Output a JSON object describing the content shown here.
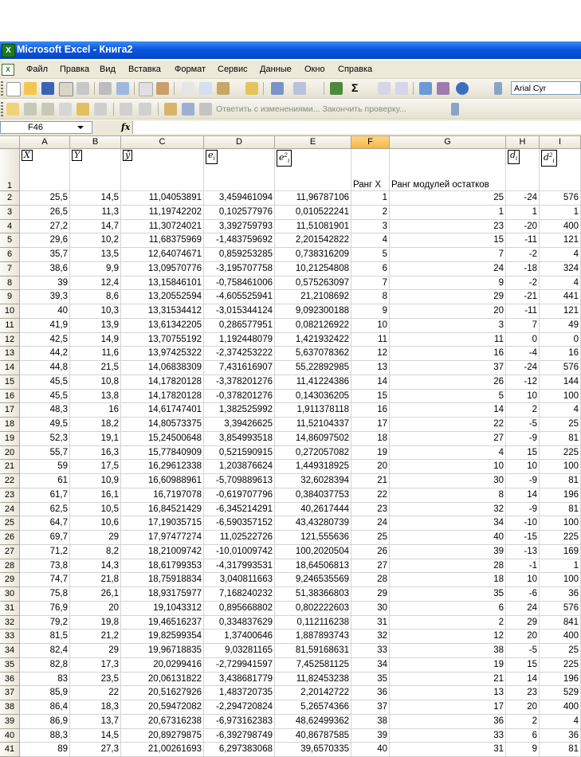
{
  "window": {
    "title": "Microsoft Excel - Книга2",
    "app_icon": "excel-icon"
  },
  "menu": [
    "Файл",
    "Правка",
    "Вид",
    "Вставка",
    "Формат",
    "Сервис",
    "Данные",
    "Окно",
    "Справка"
  ],
  "toolbar": {
    "font_name": "Arial Cyr",
    "review_text": "Ответить с изменениями... Закончить проверку...",
    "sum_glyph": "Σ"
  },
  "formula_bar": {
    "name_box": "F46",
    "fx": "fx",
    "formula": ""
  },
  "columns": [
    "A",
    "B",
    "C",
    "D",
    "E",
    "F",
    "G",
    "H",
    "I"
  ],
  "selected_column": "F",
  "header_row": {
    "A": "X",
    "B": "Y",
    "C": "ŷ",
    "D": "e_i",
    "E": "e_i²",
    "F": "Ранг X",
    "G": "Ранг модулей остатков",
    "H": "d_i",
    "I": "d_i²"
  },
  "rows": [
    [
      "25,5",
      "14,5",
      "11,04053891",
      "3,459461094",
      "11,96787106",
      "1",
      "25",
      "-24",
      "576"
    ],
    [
      "26,5",
      "11,3",
      "11,19742202",
      "0,102577976",
      "0,010522241",
      "2",
      "1",
      "1",
      "1"
    ],
    [
      "27,2",
      "14,7",
      "11,30724021",
      "3,392759793",
      "11,51081901",
      "3",
      "23",
      "-20",
      "400"
    ],
    [
      "29,6",
      "10,2",
      "11,68375969",
      "-1,483759692",
      "2,201542822",
      "4",
      "15",
      "-11",
      "121"
    ],
    [
      "35,7",
      "13,5",
      "12,64074671",
      "0,859253285",
      "0,738316209",
      "5",
      "7",
      "-2",
      "4"
    ],
    [
      "38,6",
      "9,9",
      "13,09570776",
      "-3,195707758",
      "10,21254808",
      "6",
      "24",
      "-18",
      "324"
    ],
    [
      "39",
      "12,4",
      "13,15846101",
      "-0,758461006",
      "0,575263097",
      "7",
      "9",
      "-2",
      "4"
    ],
    [
      "39,3",
      "8,6",
      "13,20552594",
      "-4,605525941",
      "21,2108692",
      "8",
      "29",
      "-21",
      "441"
    ],
    [
      "40",
      "10,3",
      "13,31534412",
      "-3,015344124",
      "9,092300188",
      "9",
      "20",
      "-11",
      "121"
    ],
    [
      "41,9",
      "13,9",
      "13,61342205",
      "0,286577951",
      "0,082126922",
      "10",
      "3",
      "7",
      "49"
    ],
    [
      "42,5",
      "14,9",
      "13,70755192",
      "1,192448079",
      "1,421932422",
      "11",
      "11",
      "0",
      "0"
    ],
    [
      "44,2",
      "11,6",
      "13,97425322",
      "-2,374253222",
      "5,637078362",
      "12",
      "16",
      "-4",
      "16"
    ],
    [
      "44,8",
      "21,5",
      "14,06838309",
      "7,431616907",
      "55,22892985",
      "13",
      "37",
      "-24",
      "576"
    ],
    [
      "45,5",
      "10,8",
      "14,17820128",
      "-3,378201276",
      "11,41224386",
      "14",
      "26",
      "-12",
      "144"
    ],
    [
      "45,5",
      "13,8",
      "14,17820128",
      "-0,378201276",
      "0,143036205",
      "15",
      "5",
      "10",
      "100"
    ],
    [
      "48,3",
      "16",
      "14,61747401",
      "1,382525992",
      "1,911378118",
      "16",
      "14",
      "2",
      "4"
    ],
    [
      "49,5",
      "18,2",
      "14,80573375",
      "3,39426625",
      "11,52104337",
      "17",
      "22",
      "-5",
      "25"
    ],
    [
      "52,3",
      "19,1",
      "15,24500648",
      "3,854993518",
      "14,86097502",
      "18",
      "27",
      "-9",
      "81"
    ],
    [
      "55,7",
      "16,3",
      "15,77840909",
      "0,521590915",
      "0,272057082",
      "19",
      "4",
      "15",
      "225"
    ],
    [
      "59",
      "17,5",
      "16,29612338",
      "1,203876624",
      "1,449318925",
      "20",
      "10",
      "10",
      "100"
    ],
    [
      "61",
      "10,9",
      "16,60988961",
      "-5,709889613",
      "32,6028394",
      "21",
      "30",
      "-9",
      "81"
    ],
    [
      "61,7",
      "16,1",
      "16,7197078",
      "-0,619707796",
      "0,384037753",
      "22",
      "8",
      "14",
      "196"
    ],
    [
      "62,5",
      "10,5",
      "16,84521429",
      "-6,345214291",
      "40,2617444",
      "23",
      "32",
      "-9",
      "81"
    ],
    [
      "64,7",
      "10,6",
      "17,19035715",
      "-6,590357152",
      "43,43280739",
      "24",
      "34",
      "-10",
      "100"
    ],
    [
      "69,7",
      "29",
      "17,97477274",
      "11,02522726",
      "121,555636",
      "25",
      "40",
      "-15",
      "225"
    ],
    [
      "71,2",
      "8,2",
      "18,21009742",
      "-10,01009742",
      "100,2020504",
      "26",
      "39",
      "-13",
      "169"
    ],
    [
      "73,8",
      "14,3",
      "18,61799353",
      "-4,317993531",
      "18,64506813",
      "27",
      "28",
      "-1",
      "1"
    ],
    [
      "74,7",
      "21,8",
      "18,75918834",
      "3,040811663",
      "9,246535569",
      "28",
      "18",
      "10",
      "100"
    ],
    [
      "75,8",
      "26,1",
      "18,93175977",
      "7,168240232",
      "51,38366803",
      "29",
      "35",
      "-6",
      "36"
    ],
    [
      "76,9",
      "20",
      "19,1043312",
      "0,895668802",
      "0,802222603",
      "30",
      "6",
      "24",
      "576"
    ],
    [
      "79,2",
      "19,8",
      "19,46516237",
      "0,334837629",
      "0,112116238",
      "31",
      "2",
      "29",
      "841"
    ],
    [
      "81,5",
      "21,2",
      "19,82599354",
      "1,37400646",
      "1,887893743",
      "32",
      "12",
      "20",
      "400"
    ],
    [
      "82,4",
      "29",
      "19,96718835",
      "9,03281165",
      "81,59168631",
      "33",
      "38",
      "-5",
      "25"
    ],
    [
      "82,8",
      "17,3",
      "20,0299416",
      "-2,729941597",
      "7,452581125",
      "34",
      "19",
      "15",
      "225"
    ],
    [
      "83",
      "23,5",
      "20,06131822",
      "3,438681779",
      "11,82453238",
      "35",
      "21",
      "14",
      "196"
    ],
    [
      "85,9",
      "22",
      "20,51627926",
      "1,483720735",
      "2,20142722",
      "36",
      "13",
      "23",
      "529"
    ],
    [
      "86,4",
      "18,3",
      "20,59472082",
      "-2,294720824",
      "5,26574366",
      "37",
      "17",
      "20",
      "400"
    ],
    [
      "86,9",
      "13,7",
      "20,67316238",
      "-6,973162383",
      "48,62499362",
      "38",
      "36",
      "2",
      "4"
    ],
    [
      "88,3",
      "14,5",
      "20,89279875",
      "-6,392798749",
      "40,86787585",
      "39",
      "33",
      "6",
      "36"
    ],
    [
      "89",
      "27,3",
      "21,00261693",
      "6,297383068",
      "39,6570335",
      "40",
      "31",
      "9",
      "81"
    ]
  ],
  "row_numbers_start": 1
}
